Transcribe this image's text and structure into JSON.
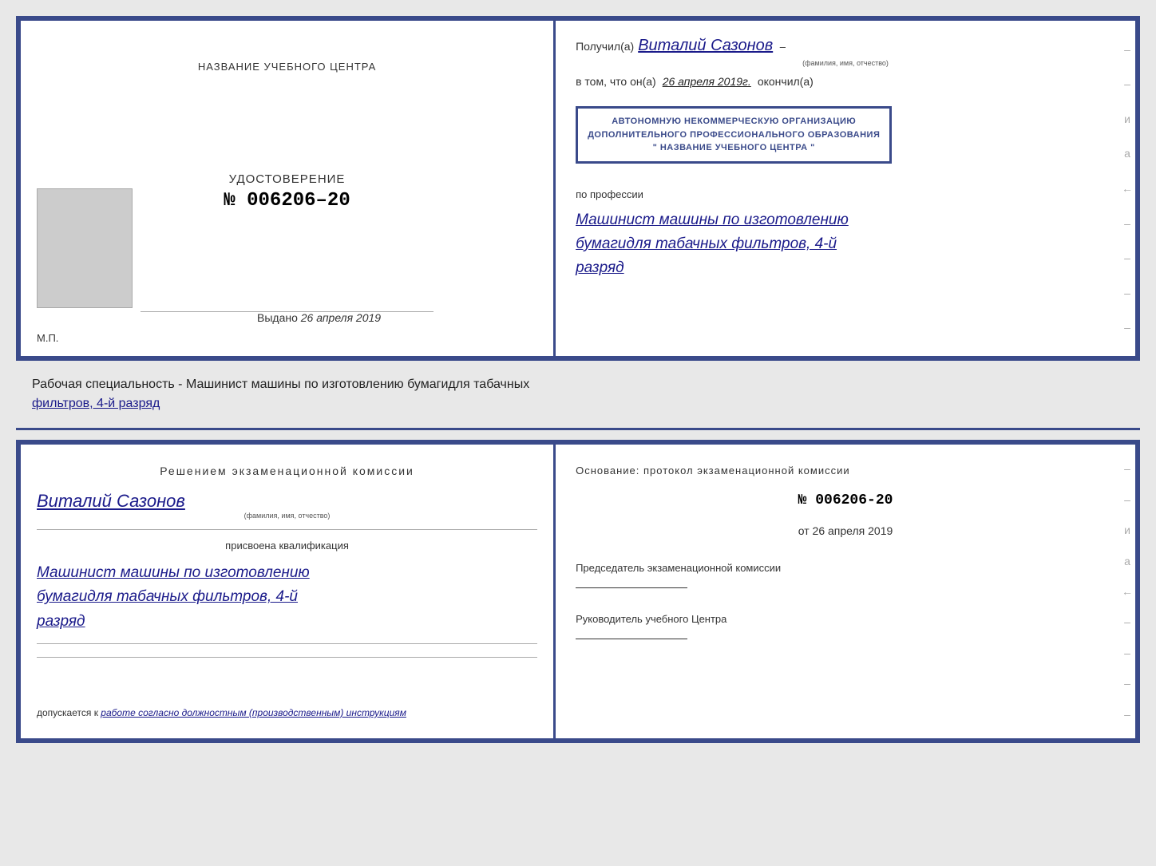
{
  "top_left": {
    "center_title": "НАЗВАНИЕ УЧЕБНОГО ЦЕНТРА",
    "udostoverenie_label": "УДОСТОВЕРЕНИЕ",
    "udostoverenie_number": "№ 006206–20",
    "vydano_label": "Выдано",
    "vydano_date": "26 апреля 2019",
    "mp": "М.П."
  },
  "top_right": {
    "poluchil_prefix": "Получил(а)",
    "poluchil_name": "Виталий Сазонов",
    "poluchil_caption": "(фамилия, имя, отчество)",
    "vtom_prefix": "в том, что он(а)",
    "vtom_date": "26 апреля 2019г.",
    "okonchil": "окончил(а)",
    "stamp_line1": "АВТОНОМНУЮ НЕКОММЕРЧЕСКУЮ ОРГАНИЗАЦИЮ",
    "stamp_line2": "ДОПОЛНИТЕЛЬНОГО ПРОФЕССИОНАЛЬНОГО ОБРАЗОВАНИЯ",
    "stamp_line3": "\" НАЗВАНИЕ УЧЕБНОГО ЦЕНТРА \"",
    "po_professii": "по профессии",
    "profession1": "Машинист машины по изготовлению",
    "profession2": "бумагидля табачных фильтров, 4-й",
    "profession3": "разряд"
  },
  "middle": {
    "text": "Рабочая специальность - Машинист машины по изготовлению бумагидля табачных",
    "text2": "фильтров, 4-й разряд"
  },
  "bottom_left": {
    "resheniem": "Решением  экзаменационной  комиссии",
    "name": "Виталий Сазонов",
    "name_caption": "(фамилия, имя, отчество)",
    "prisvoena": "присвоена квалификация",
    "kvali1": "Машинист машины по изготовлению",
    "kvali2": "бумагидля табачных фильтров, 4-й",
    "kvali3": "разряд",
    "dopuskaetsya_prefix": "допускается к",
    "dopuskaetsya_italic": "работе согласно должностным (производственным) инструкциям"
  },
  "bottom_right": {
    "osnovanie": "Основание: протокол экзаменационной  комиссии",
    "number": "№  006206-20",
    "ot_prefix": "от",
    "ot_date": "26 апреля 2019",
    "predsedatel_label": "Председатель экзаменационной комиссии",
    "rukovoditel_label": "Руководитель учебного Центра"
  },
  "dashes": [
    "–",
    "–",
    "и",
    "а",
    "←",
    "–",
    "–",
    "–",
    "–"
  ]
}
